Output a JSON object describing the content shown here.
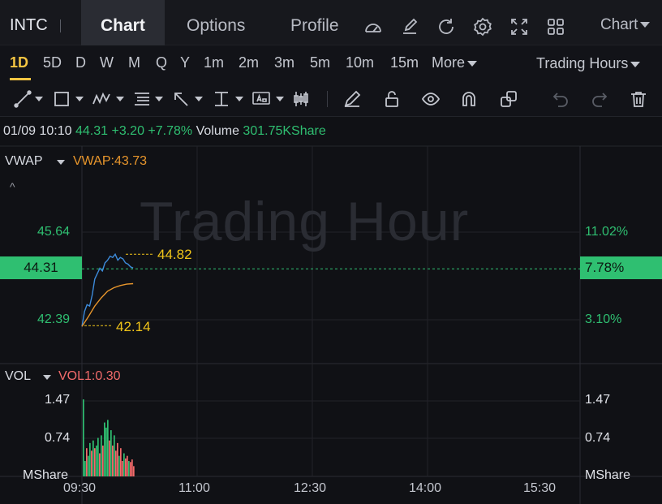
{
  "header": {
    "ticker": "INTC",
    "tabs": [
      {
        "label": "Chart",
        "active": true
      },
      {
        "label": "Options"
      },
      {
        "label": "Profile"
      }
    ],
    "icons": [
      "gauge-icon",
      "edit-icon",
      "refresh-icon",
      "settings-icon",
      "fullscreen-icon",
      "grid-icon"
    ],
    "chart_dropdown": "Chart"
  },
  "periods": {
    "items": [
      "1D",
      "5D",
      "D",
      "W",
      "M",
      "Q",
      "Y",
      "1m",
      "2m",
      "3m",
      "5m",
      "10m",
      "15m"
    ],
    "more": "More",
    "active": "1D",
    "trading_hours": "Trading Hours"
  },
  "toolbar": {
    "tools": [
      "trendline-icon",
      "rectangle-icon",
      "pattern-icon",
      "fib-icon",
      "arrow-icon",
      "measure-icon",
      "text-icon",
      "candle-icon",
      "pencil-icon",
      "unlock-icon",
      "eye-icon",
      "magnet-icon",
      "link-icon",
      "undo-icon",
      "redo-icon",
      "trash-icon"
    ]
  },
  "quote": {
    "time": "01/09 10:10",
    "price": "44.31",
    "change": "+3.20",
    "change_pct": "+7.78%",
    "volume_label": "Volume",
    "volume": "301.75KShare"
  },
  "main_pane": {
    "indicator": "VWAP",
    "indicator_value": "VWAP:43.73",
    "watermark": "Trading Hour",
    "y_left": [
      "45.64",
      "42.39"
    ],
    "y_right": [
      "11.02%",
      "3.10%"
    ],
    "current_price": "44.31",
    "current_pct": "7.78%",
    "high_marker": "44.82",
    "low_marker": "42.14"
  },
  "volume_pane": {
    "indicator": "VOL",
    "indicator_value": "VOL1:0.30",
    "y_left": [
      "1.47",
      "0.74",
      "MShare"
    ],
    "y_right": [
      "1.47",
      "0.74",
      "MShare"
    ]
  },
  "x_axis": [
    "09:30",
    "11:00",
    "12:30",
    "14:00",
    "15:30"
  ],
  "colors": {
    "up": "#2fbf71",
    "down": "#f26b6b",
    "vwap": "#e8962c",
    "price": "#3d8bdb",
    "accent": "#f5c542"
  },
  "chart_data": {
    "type": "line",
    "series": [
      {
        "name": "price",
        "x": [
          "09:30",
          "09:32",
          "09:34",
          "09:36",
          "09:38",
          "09:40",
          "09:42",
          "09:44",
          "09:46",
          "09:48",
          "09:50",
          "09:52",
          "09:54",
          "09:56",
          "09:58",
          "10:00",
          "10:02",
          "10:04",
          "10:06",
          "10:08",
          "10:10"
        ],
        "values": [
          42.14,
          42.7,
          42.95,
          42.9,
          43.3,
          43.9,
          44.1,
          44.3,
          44.2,
          44.5,
          44.6,
          44.75,
          44.7,
          44.82,
          44.6,
          44.7,
          44.65,
          44.5,
          44.45,
          44.35,
          44.31
        ]
      },
      {
        "name": "VWAP",
        "x": [
          "09:30",
          "09:35",
          "09:40",
          "09:45",
          "09:50",
          "09:55",
          "10:00",
          "10:05",
          "10:10"
        ],
        "values": [
          42.14,
          42.5,
          42.9,
          43.2,
          43.45,
          43.58,
          43.66,
          43.71,
          43.73
        ]
      }
    ],
    "volume": [
      1.5,
      0.3,
      0.55,
      0.4,
      0.65,
      0.5,
      0.7,
      0.55,
      0.6,
      0.75,
      0.45,
      0.8,
      0.6,
      1.05,
      0.95,
      1.1,
      0.7,
      0.9,
      0.6,
      0.8,
      0.5,
      0.65,
      0.4,
      0.55,
      0.3,
      0.45,
      0.35,
      0.4,
      0.3,
      0.28,
      0.33,
      0.2
    ],
    "volume_up": [
      true,
      true,
      false,
      true,
      true,
      false,
      true,
      false,
      true,
      true,
      false,
      true,
      false,
      true,
      true,
      true,
      false,
      true,
      false,
      true,
      false,
      false,
      true,
      false,
      false,
      true,
      false,
      false,
      true,
      false,
      false,
      false
    ],
    "ylim": [
      41.5,
      46.2
    ],
    "volume_ylim": [
      0,
      1.6
    ]
  }
}
